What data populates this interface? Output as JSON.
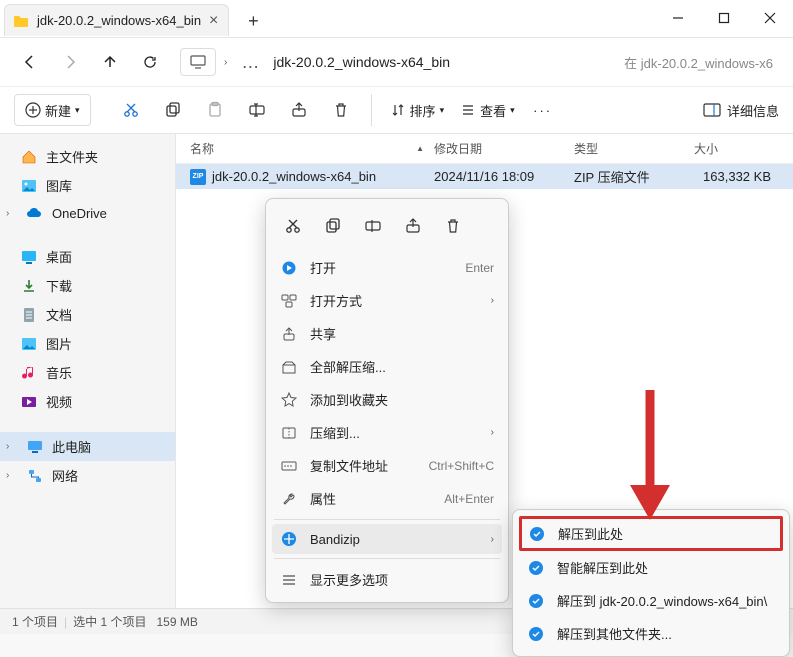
{
  "tab": {
    "title": "jdk-20.0.2_windows-x64_bin"
  },
  "nav": {
    "path": "jdk-20.0.2_windows-x64_bin",
    "search_placeholder": "在 jdk-20.0.2_windows-x6"
  },
  "toolbar": {
    "new_label": "新建",
    "sort_label": "排序",
    "view_label": "查看",
    "details_label": "详细信息"
  },
  "columns": {
    "name": "名称",
    "date": "修改日期",
    "type": "类型",
    "size": "大小"
  },
  "sidebar": {
    "home": "主文件夹",
    "gallery": "图库",
    "onedrive": "OneDrive",
    "desktop": "桌面",
    "downloads": "下载",
    "documents": "文档",
    "pictures": "图片",
    "music": "音乐",
    "videos": "视频",
    "this_pc": "此电脑",
    "network": "网络"
  },
  "file": {
    "name": "jdk-20.0.2_windows-x64_bin",
    "date": "2024/11/16 18:09",
    "type": "ZIP 压缩文件",
    "size": "163,332 KB",
    "zip_badge": "ZIP"
  },
  "ctx": {
    "open": "打开",
    "open_sc": "Enter",
    "open_with": "打开方式",
    "share": "共享",
    "extract_all": "全部解压缩...",
    "add_fav": "添加到收藏夹",
    "compress": "压缩到...",
    "copy_path": "复制文件地址",
    "copy_path_sc": "Ctrl+Shift+C",
    "properties": "属性",
    "properties_sc": "Alt+Enter",
    "bandizip": "Bandizip",
    "show_more": "显示更多选项"
  },
  "submenu": {
    "extract_here": "解压到此处",
    "smart_extract": "智能解压到此处",
    "extract_to_folder": "解压到 jdk-20.0.2_windows-x64_bin\\",
    "extract_other": "解压到其他文件夹..."
  },
  "status": {
    "items": "1 个项目",
    "selected": "选中 1 个项目",
    "size": "159 MB"
  }
}
